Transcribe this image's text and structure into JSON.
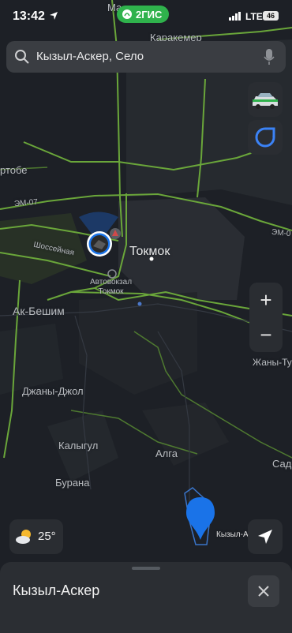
{
  "status_bar": {
    "time": "13:42",
    "brand": "2ГИС",
    "network": "LTE",
    "battery": "46"
  },
  "search": {
    "value": "Кызыл-Аскер, Село",
    "icon": "search-icon",
    "mic_icon": "microphone-icon"
  },
  "map_labels": {
    "karakemer": "Каракемер",
    "ma": "Ма",
    "rtobe": "ртобе",
    "em07_left": "ЭМ-07",
    "em07_right": "ЭМ-0",
    "shosseynaya": "Шоссейная",
    "tokmok": "Токмок",
    "bus_station_line1": "Автовокзал",
    "bus_station_line2": "Токмок",
    "ak_beshim": "Ак-Бешим",
    "zhany_tu": "Жаны-Ту",
    "zhany_zhol": "Джаны-Джол",
    "kalygul": "Калыгул",
    "alga": "Алга",
    "sado": "Садо",
    "burana": "Бурана",
    "kyzyl_a": "Кызыл-А"
  },
  "controls": {
    "zoom_in": "+",
    "zoom_out": "−"
  },
  "weather": {
    "temperature": "25°",
    "icon": "partly-cloudy-icon"
  },
  "bottom_sheet": {
    "title": "Кызыл-Аскер"
  },
  "colors": {
    "map_background": "#1d2026",
    "road_green": "#6aa63a",
    "brand_green": "#2fb24c",
    "pin_blue": "#1a73e8"
  }
}
